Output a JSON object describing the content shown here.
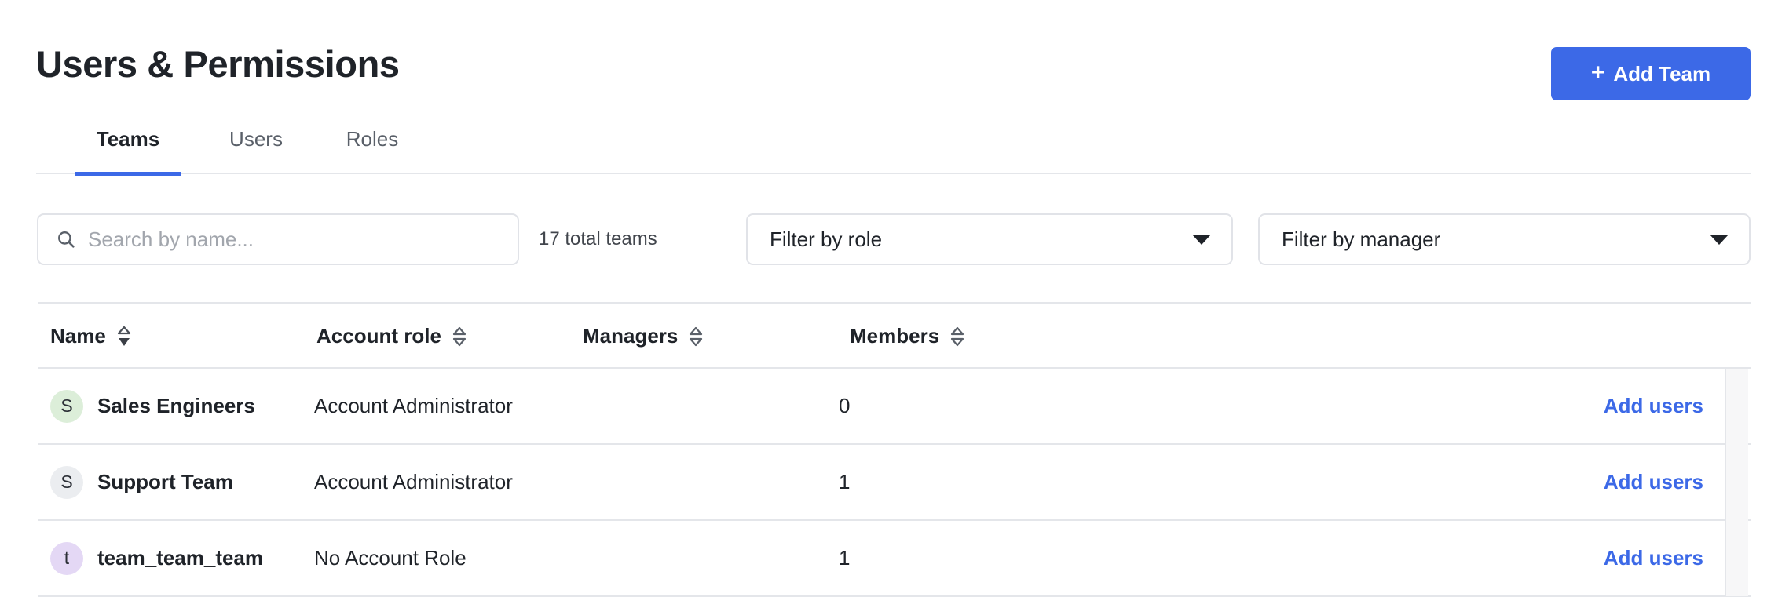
{
  "header": {
    "title": "Users & Permissions",
    "add_team_label": "Add Team",
    "plus_glyph": "+"
  },
  "tabs": [
    {
      "label": "Teams",
      "active": true
    },
    {
      "label": "Users",
      "active": false
    },
    {
      "label": "Roles",
      "active": false
    }
  ],
  "filters": {
    "search_placeholder": "Search by name...",
    "search_value": "",
    "total_count_label": "17 total teams",
    "role_filter_label": "Filter by role",
    "manager_filter_label": "Filter by manager"
  },
  "table": {
    "columns": [
      {
        "label": "Name",
        "sort": "desc"
      },
      {
        "label": "Account role",
        "sort": "none"
      },
      {
        "label": "Managers",
        "sort": "none"
      },
      {
        "label": "Members",
        "sort": "none"
      }
    ],
    "rows": [
      {
        "avatar_letter": "S",
        "avatar_color": "#dceed9",
        "name": "Sales Engineers",
        "account_role": "Account Administrator",
        "managers": "",
        "members": "0",
        "action_label": "Add users"
      },
      {
        "avatar_letter": "S",
        "avatar_color": "#ebedf0",
        "name": "Support Team",
        "account_role": "Account Administrator",
        "managers": "",
        "members": "1",
        "action_label": "Add users"
      },
      {
        "avatar_letter": "t",
        "avatar_color": "#e4d8f5",
        "name": "team_team_team",
        "account_role": "No Account Role",
        "managers": "",
        "members": "1",
        "action_label": "Add users"
      }
    ]
  },
  "colors": {
    "accent": "#3c69e7",
    "text": "#1f2329",
    "muted": "#5a6069",
    "border": "#e4e6ea",
    "placeholder": "#a2a6ad"
  }
}
